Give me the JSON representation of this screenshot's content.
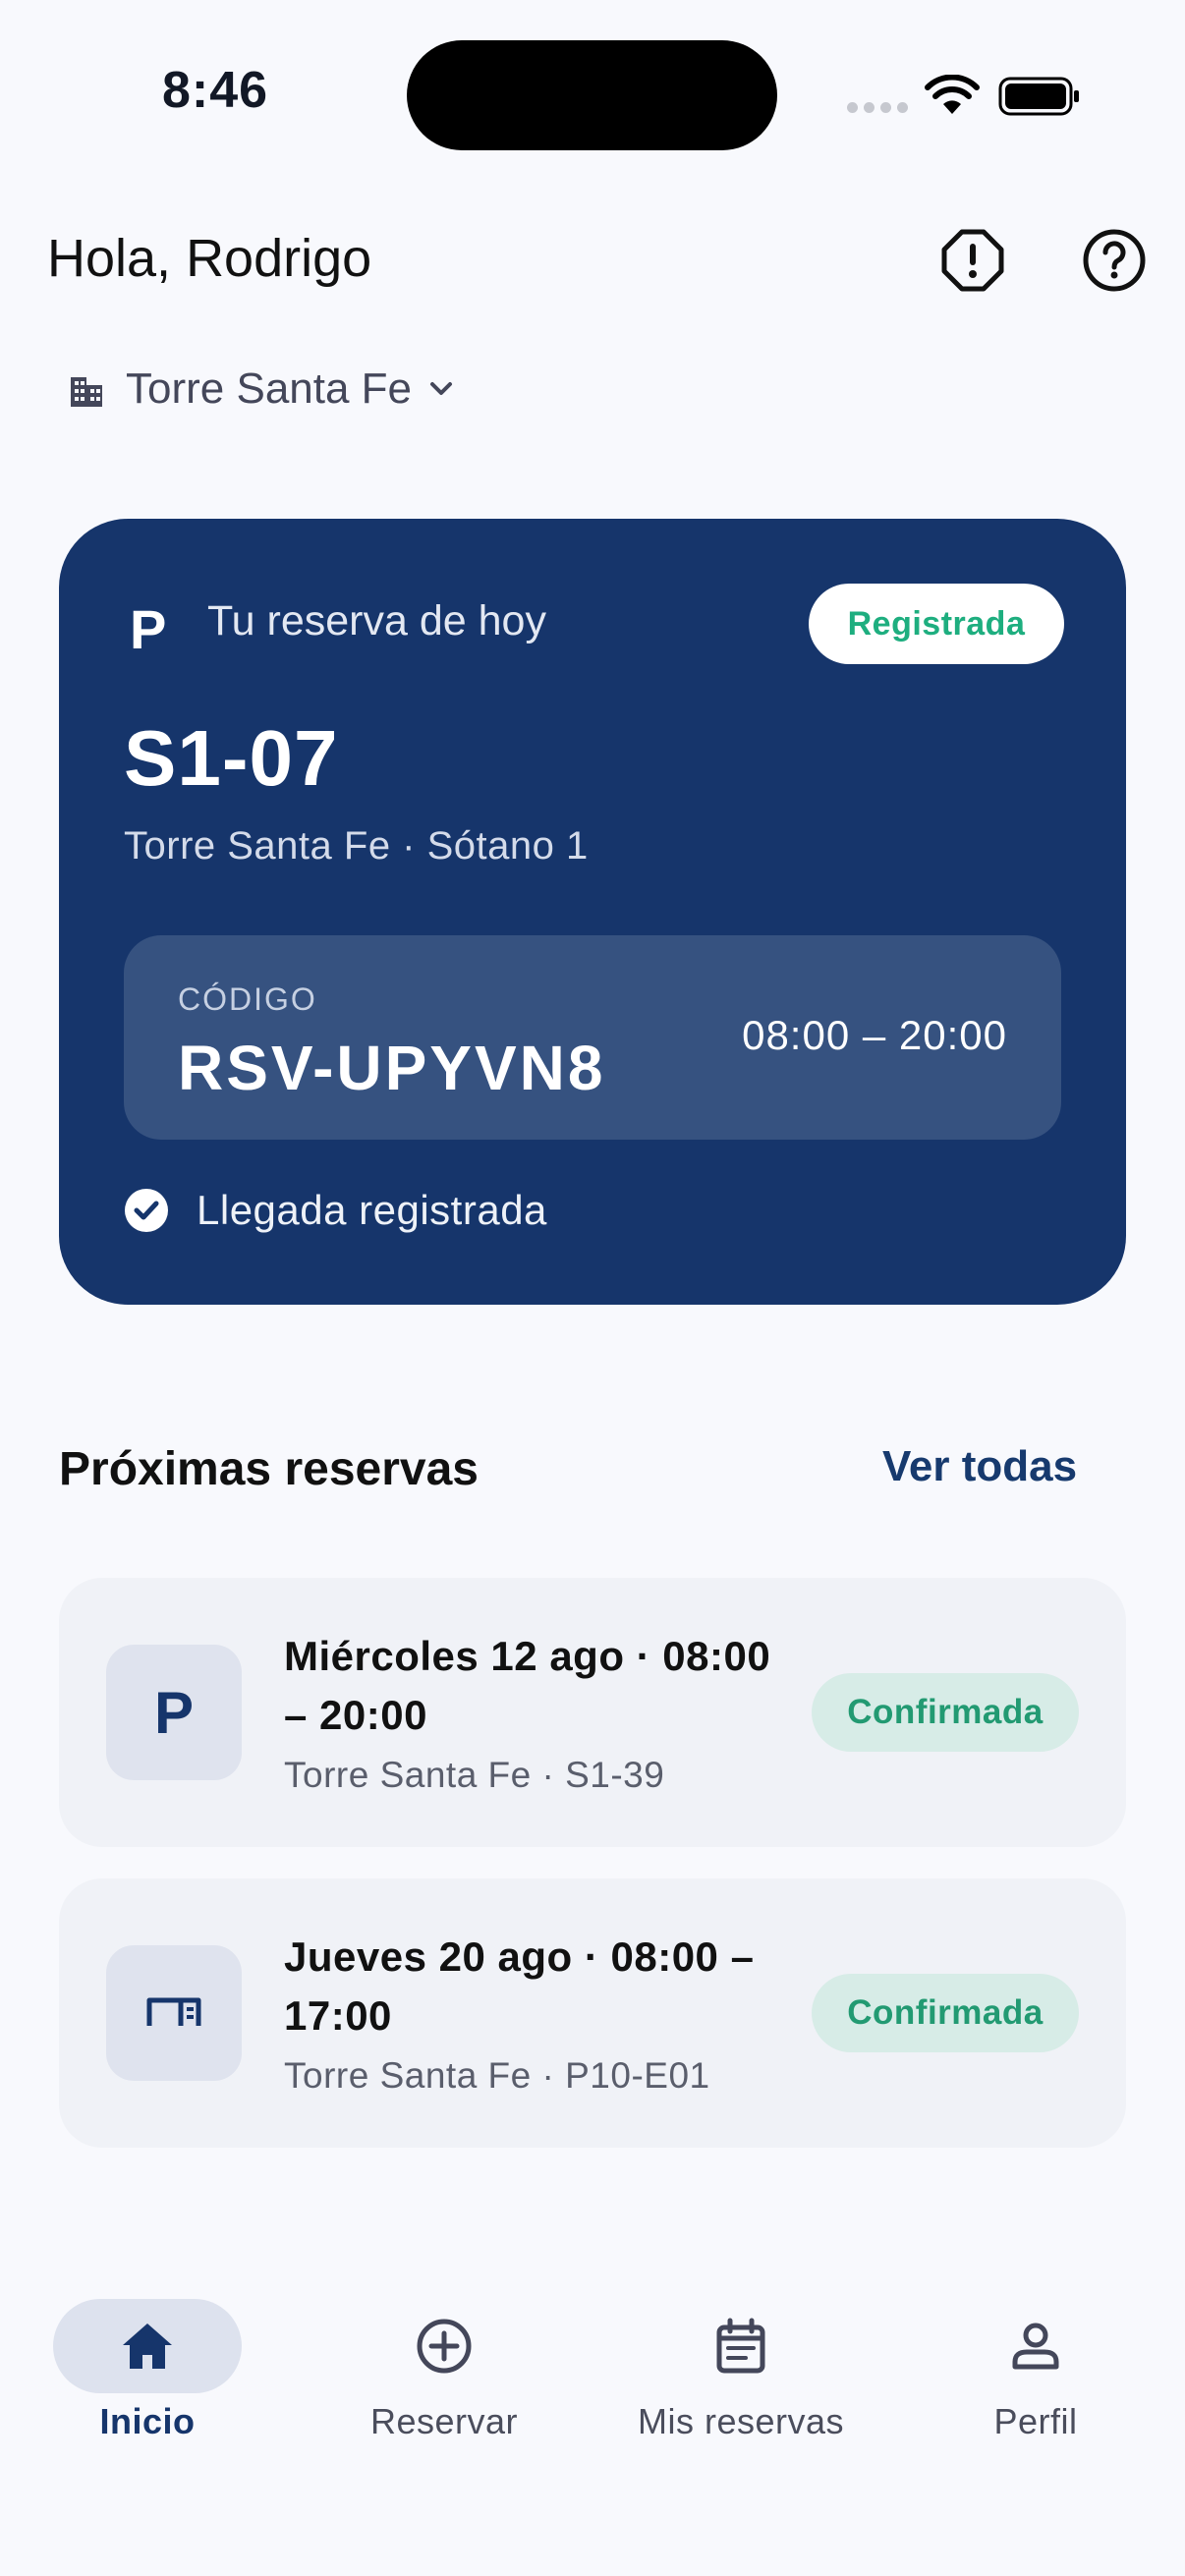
{
  "status_bar": {
    "time": "8:46"
  },
  "header": {
    "greeting": "Hola, Rodrigo",
    "report_icon": "alert-octagon-icon",
    "help_icon": "help-circle-icon"
  },
  "building": {
    "name": "Torre Santa Fe",
    "icon": "building-icon"
  },
  "today": {
    "label": "Tu reserva de hoy",
    "parking_glyph": "P",
    "status": "Registrada",
    "spot": "S1-07",
    "location": "Torre Santa Fe · Sótano 1",
    "code_label": "CÓDIGO",
    "code": "RSV-UPYVN8",
    "time": "08:00 – 20:00",
    "arrival": "Llegada registrada"
  },
  "upcoming": {
    "title": "Próximas reservas",
    "see_all": "Ver todas",
    "items": [
      {
        "type": "parking",
        "glyph": "P",
        "title": "Miércoles 12 ago · 08:00 – 20:00",
        "subtitle": "Torre Santa Fe · S1-39",
        "status": "Confirmada"
      },
      {
        "type": "desk",
        "icon": "desk-icon",
        "title": "Jueves 20 ago · 08:00 – 17:00",
        "subtitle": "Torre Santa Fe · P10-E01",
        "status": "Confirmada"
      }
    ]
  },
  "nav": {
    "items": [
      {
        "label": "Inicio",
        "icon": "home-icon",
        "active": true
      },
      {
        "label": "Reservar",
        "icon": "plus-circle-icon",
        "active": false
      },
      {
        "label": "Mis reservas",
        "icon": "calendar-icon",
        "active": false
      },
      {
        "label": "Perfil",
        "icon": "person-icon",
        "active": false
      }
    ]
  },
  "colors": {
    "primary": "#16356b",
    "success": "#1eae7f",
    "background": "#f8f9fd"
  }
}
